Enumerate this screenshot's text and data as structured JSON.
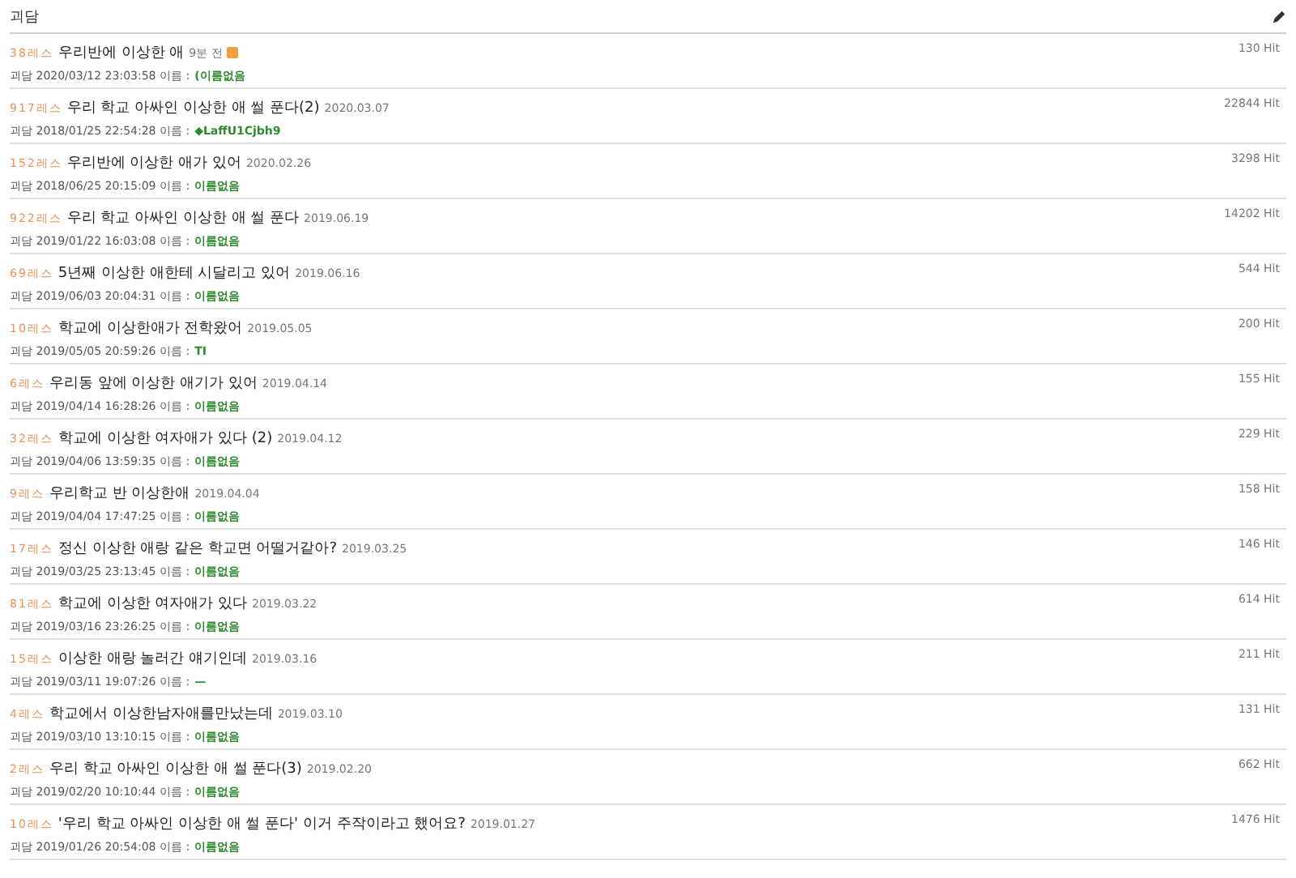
{
  "board": {
    "title": "괴담"
  },
  "threads": [
    {
      "replies": "38레스",
      "title": "우리반에 이상한 애",
      "date": "9분 전",
      "new": true,
      "category": "괴담",
      "created": "2020/03/12 23:03:58",
      "name_label": "이름 :",
      "name": "(이름없음",
      "hits": "130 Hit"
    },
    {
      "replies": "917레스",
      "title": "우리 학교 아싸인 이상한 애 썰 푼다(2)",
      "date": "2020.03.07",
      "new": false,
      "category": "괴담",
      "created": "2018/01/25 22:54:28",
      "name_label": "이름 :",
      "name": "◆LaffU1Cjbh9",
      "hits": "22844 Hit"
    },
    {
      "replies": "152레스",
      "title": "우리반에 이상한 애가 있어",
      "date": "2020.02.26",
      "new": false,
      "category": "괴담",
      "created": "2018/06/25 20:15:09",
      "name_label": "이름 :",
      "name": "이름없음",
      "hits": "3298 Hit"
    },
    {
      "replies": "922레스",
      "title": "우리 학교 아싸인 이상한 애 썰 푼다",
      "date": "2019.06.19",
      "new": false,
      "category": "괴담",
      "created": "2019/01/22 16:03:08",
      "name_label": "이름 :",
      "name": "이름없음",
      "hits": "14202 Hit"
    },
    {
      "replies": "69레스",
      "title": "5년째 이상한 애한테 시달리고 있어",
      "date": "2019.06.16",
      "new": false,
      "category": "괴담",
      "created": "2019/06/03 20:04:31",
      "name_label": "이름 :",
      "name": "이름없음",
      "hits": "544 Hit"
    },
    {
      "replies": "10레스",
      "title": "학교에 이상한애가 전학왔어",
      "date": "2019.05.05",
      "new": false,
      "category": "괴담",
      "created": "2019/05/05 20:59:26",
      "name_label": "이름 :",
      "name": "TI",
      "hits": "200 Hit"
    },
    {
      "replies": "6레스",
      "title": "우리동 앞에 이상한 애기가 있어",
      "date": "2019.04.14",
      "new": false,
      "category": "괴담",
      "created": "2019/04/14 16:28:26",
      "name_label": "이름 :",
      "name": "이름없음",
      "hits": "155 Hit"
    },
    {
      "replies": "32레스",
      "title": "학교에 이상한 여자애가 있다 (2)",
      "date": "2019.04.12",
      "new": false,
      "category": "괴담",
      "created": "2019/04/06 13:59:35",
      "name_label": "이름 :",
      "name": "이름없음",
      "hits": "229 Hit"
    },
    {
      "replies": "9레스",
      "title": "우리학교 반 이상한애",
      "date": "2019.04.04",
      "new": false,
      "category": "괴담",
      "created": "2019/04/04 17:47:25",
      "name_label": "이름 :",
      "name": "이름없음",
      "hits": "158 Hit"
    },
    {
      "replies": "17레스",
      "title": "정신 이상한 애랑 같은 학교면 어떨거같아?",
      "date": "2019.03.25",
      "new": false,
      "category": "괴담",
      "created": "2019/03/25 23:13:45",
      "name_label": "이름 :",
      "name": "이름없음",
      "hits": "146 Hit"
    },
    {
      "replies": "81레스",
      "title": "학교에 이상한 여자애가 있다",
      "date": "2019.03.22",
      "new": false,
      "category": "괴담",
      "created": "2019/03/16 23:26:25",
      "name_label": "이름 :",
      "name": "이름없음",
      "hits": "614 Hit"
    },
    {
      "replies": "15레스",
      "title": "이상한 애랑 놀러간 얘기인데",
      "date": "2019.03.16",
      "new": false,
      "category": "괴담",
      "created": "2019/03/11 19:07:26",
      "name_label": "이름 :",
      "name": "—",
      "hits": "211 Hit"
    },
    {
      "replies": "4레스",
      "title": "학교에서 이상한남자애를만났는데",
      "date": "2019.03.10",
      "new": false,
      "category": "괴담",
      "created": "2019/03/10 13:10:15",
      "name_label": "이름 :",
      "name": "이름없음",
      "hits": "131 Hit"
    },
    {
      "replies": "2레스",
      "title": "우리 학교 아싸인 이상한 애 썰 푼다(3)",
      "date": "2019.02.20",
      "new": false,
      "category": "괴담",
      "created": "2019/02/20 10:10:44",
      "name_label": "이름 :",
      "name": "이름없음",
      "hits": "662 Hit"
    },
    {
      "replies": "10레스",
      "title": "'우리 학교 아싸인 이상한 애 썰 푼다' 이거 주작이라고 했어요?",
      "date": "2019.01.27",
      "new": false,
      "category": "괴담",
      "created": "2019/01/26 20:54:08",
      "name_label": "이름 :",
      "name": "이름없음",
      "hits": "1476 Hit"
    }
  ]
}
